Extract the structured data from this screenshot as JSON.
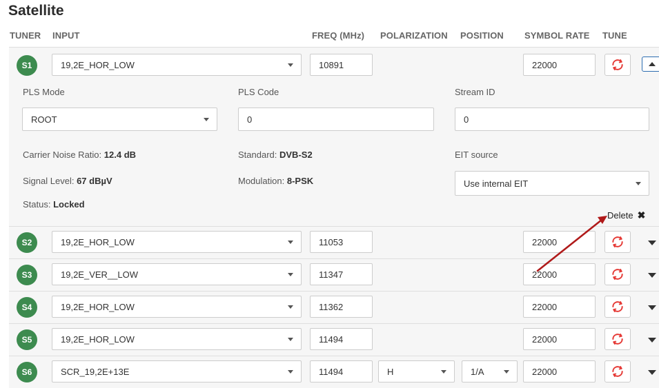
{
  "page": {
    "title": "Satellite"
  },
  "headers": {
    "tuner": "TUNER",
    "input": "INPUT",
    "freq": "FREQ (MHz)",
    "polarization": "POLARIZATION",
    "position": "POSITION",
    "symbol_rate": "SYMBOL RATE",
    "tune": "TUNE"
  },
  "expanded": {
    "pls_mode_label": "PLS Mode",
    "pls_mode_value": "ROOT",
    "pls_code_label": "PLS Code",
    "pls_code_value": "0",
    "stream_id_label": "Stream ID",
    "stream_id_value": "0",
    "cnr_label": "Carrier Noise Ratio:",
    "cnr_value": "12.4 dB",
    "standard_label": "Standard:",
    "standard_value": "DVB-S2",
    "eit_label": "EIT source",
    "eit_value": "Use internal EIT",
    "signal_label": "Signal Level:",
    "signal_value": "67 dBµV",
    "modulation_label": "Modulation:",
    "modulation_value": "8-PSK",
    "status_label": "Status:",
    "status_value": "Locked",
    "delete_label": "Delete"
  },
  "tuners": [
    {
      "id": "S1",
      "input": "19,2E_HOR_LOW",
      "freq": "10891",
      "symbol_rate": "22000"
    },
    {
      "id": "S2",
      "input": "19,2E_HOR_LOW",
      "freq": "11053",
      "symbol_rate": "22000"
    },
    {
      "id": "S3",
      "input": "19,2E_VER__LOW",
      "freq": "11347",
      "symbol_rate": "22000"
    },
    {
      "id": "S4",
      "input": "19,2E_HOR_LOW",
      "freq": "11362",
      "symbol_rate": "22000"
    },
    {
      "id": "S5",
      "input": "19,2E_HOR_LOW",
      "freq": "11494",
      "symbol_rate": "22000"
    },
    {
      "id": "S6",
      "input": "SCR_19,2E+13E",
      "freq": "11494",
      "polarization": "H",
      "position": "1/A",
      "symbol_rate": "22000"
    }
  ],
  "colors": {
    "badge": "#3d8b4f",
    "tune_icon": "#e53935",
    "annotation_arrow": "#b01a1a"
  }
}
